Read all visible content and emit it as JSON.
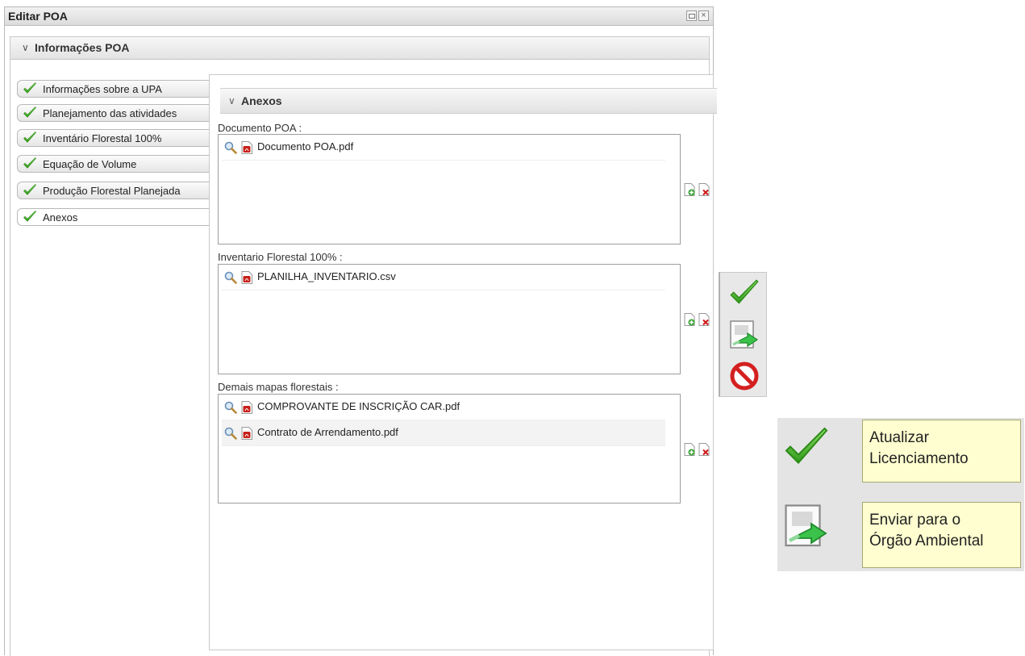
{
  "window": {
    "title": "Editar POA"
  },
  "section": {
    "title": "Informações POA"
  },
  "nav": {
    "items": [
      {
        "label": "Informações sobre a UPA",
        "done": true
      },
      {
        "label": "Planejamento das atividades",
        "done": true
      },
      {
        "label": "Inventário Florestal 100%",
        "done": true
      },
      {
        "label": "Equação de Volume",
        "done": true
      },
      {
        "label": "Produção Florestal Planejada",
        "done": true
      },
      {
        "label": "Anexos",
        "done": true,
        "active": true
      }
    ]
  },
  "anexos": {
    "title": "Anexos",
    "groups": [
      {
        "label": "Documento POA :",
        "files": [
          "Documento POA.pdf"
        ]
      },
      {
        "label": "Inventario Florestal 100% :",
        "files": [
          "PLANILHA_INVENTARIO.csv"
        ]
      },
      {
        "label": "Demais mapas florestais :",
        "files": [
          "COMPROVANTE DE INSCRIÇÃO CAR.pdf",
          "Contrato de Arrendamento.pdf"
        ]
      }
    ]
  },
  "toolbar": {
    "buttons": [
      "check-icon",
      "send-document-icon",
      "cancel-icon"
    ]
  },
  "legend": {
    "update_tooltip_line1": "Atualizar",
    "update_tooltip_line2": "Licenciamento",
    "send_tooltip_line1": "Enviar para o",
    "send_tooltip_line2": "Órgão Ambiental"
  },
  "colors": {
    "check_green": "#4caf2a",
    "cancel_red": "#d02020",
    "tooltip_bg": "#fefed0",
    "pdf_red": "#c8201a"
  }
}
